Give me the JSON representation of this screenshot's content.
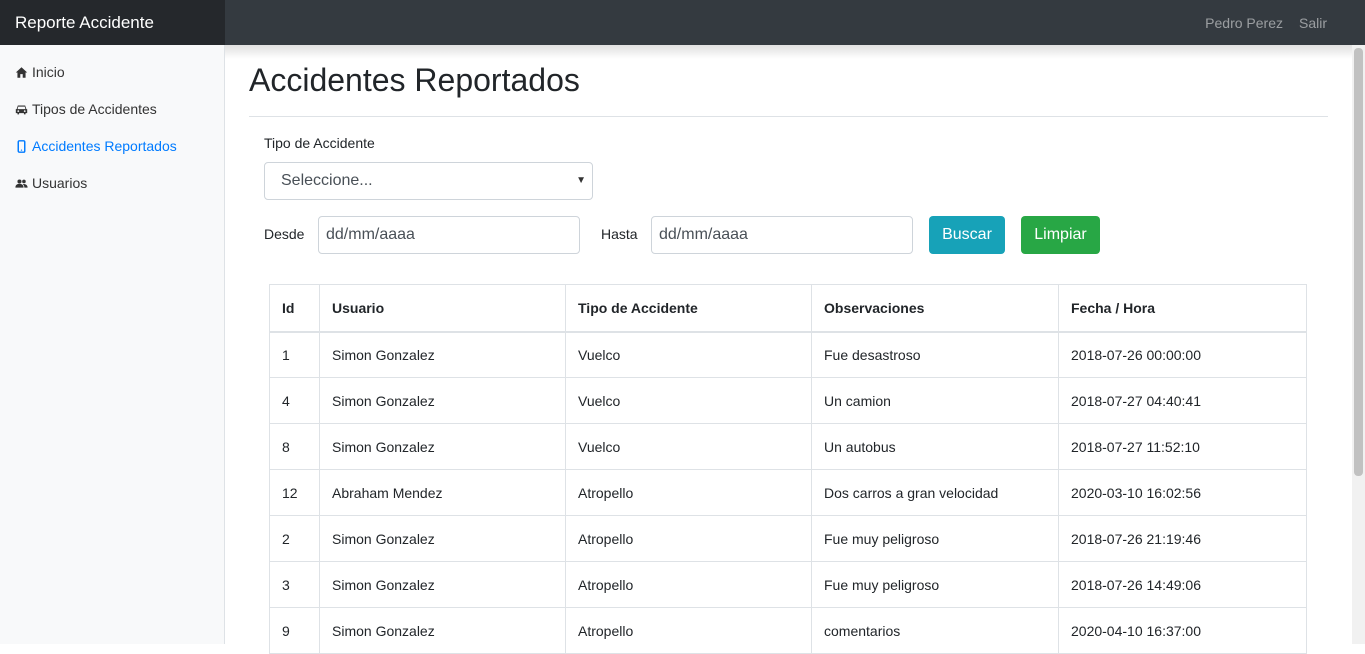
{
  "navbar": {
    "brand": "Reporte Accidente",
    "user": "Pedro Perez",
    "logout": "Salir"
  },
  "sidebar": {
    "items": [
      {
        "label": "Inicio",
        "icon": "home-icon"
      },
      {
        "label": "Tipos de Accidentes",
        "icon": "car-icon"
      },
      {
        "label": "Accidentes Reportados",
        "icon": "mobile-icon",
        "active": true
      },
      {
        "label": "Usuarios",
        "icon": "users-icon"
      }
    ]
  },
  "page": {
    "title": "Accidentes Reportados"
  },
  "filters": {
    "type_label": "Tipo de Accidente",
    "type_selected": "Seleccione...",
    "from_label": "Desde",
    "from_placeholder": "dd/mm/aaaa",
    "to_label": "Hasta",
    "to_placeholder": "dd/mm/aaaa",
    "search_button": "Buscar",
    "clear_button": "Limpiar"
  },
  "table": {
    "headers": [
      "Id",
      "Usuario",
      "Tipo de Accidente",
      "Observaciones",
      "Fecha / Hora"
    ],
    "rows": [
      [
        "1",
        "Simon Gonzalez",
        "Vuelco",
        "Fue desastroso",
        "2018-07-26 00:00:00"
      ],
      [
        "4",
        "Simon Gonzalez",
        "Vuelco",
        "Un camion",
        "2018-07-27 04:40:41"
      ],
      [
        "8",
        "Simon Gonzalez",
        "Vuelco",
        "Un autobus",
        "2018-07-27 11:52:10"
      ],
      [
        "12",
        "Abraham Mendez",
        "Atropello",
        "Dos carros a gran velocidad",
        "2020-03-10 16:02:56"
      ],
      [
        "2",
        "Simon Gonzalez",
        "Atropello",
        "Fue muy peligroso",
        "2018-07-26 21:19:46"
      ],
      [
        "3",
        "Simon Gonzalez",
        "Atropello",
        "Fue muy peligroso",
        "2018-07-26 14:49:06"
      ],
      [
        "9",
        "Simon Gonzalez",
        "Atropello",
        "comentarios",
        "2020-04-10 16:37:00"
      ]
    ]
  },
  "colors": {
    "navbar": "#343a40",
    "brand_bg": "#25282c",
    "active_link": "#007bff",
    "info": "#17a2b8",
    "success": "#28a745"
  }
}
